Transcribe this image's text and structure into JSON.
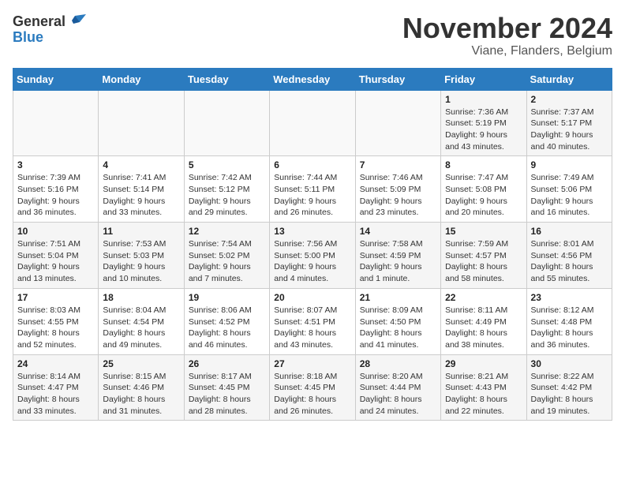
{
  "logo": {
    "general": "General",
    "blue": "Blue"
  },
  "title": {
    "month": "November 2024",
    "location": "Viane, Flanders, Belgium"
  },
  "headers": [
    "Sunday",
    "Monday",
    "Tuesday",
    "Wednesday",
    "Thursday",
    "Friday",
    "Saturday"
  ],
  "weeks": [
    [
      {
        "day": "",
        "info": ""
      },
      {
        "day": "",
        "info": ""
      },
      {
        "day": "",
        "info": ""
      },
      {
        "day": "",
        "info": ""
      },
      {
        "day": "",
        "info": ""
      },
      {
        "day": "1",
        "info": "Sunrise: 7:36 AM\nSunset: 5:19 PM\nDaylight: 9 hours and 43 minutes."
      },
      {
        "day": "2",
        "info": "Sunrise: 7:37 AM\nSunset: 5:17 PM\nDaylight: 9 hours and 40 minutes."
      }
    ],
    [
      {
        "day": "3",
        "info": "Sunrise: 7:39 AM\nSunset: 5:16 PM\nDaylight: 9 hours and 36 minutes."
      },
      {
        "day": "4",
        "info": "Sunrise: 7:41 AM\nSunset: 5:14 PM\nDaylight: 9 hours and 33 minutes."
      },
      {
        "day": "5",
        "info": "Sunrise: 7:42 AM\nSunset: 5:12 PM\nDaylight: 9 hours and 29 minutes."
      },
      {
        "day": "6",
        "info": "Sunrise: 7:44 AM\nSunset: 5:11 PM\nDaylight: 9 hours and 26 minutes."
      },
      {
        "day": "7",
        "info": "Sunrise: 7:46 AM\nSunset: 5:09 PM\nDaylight: 9 hours and 23 minutes."
      },
      {
        "day": "8",
        "info": "Sunrise: 7:47 AM\nSunset: 5:08 PM\nDaylight: 9 hours and 20 minutes."
      },
      {
        "day": "9",
        "info": "Sunrise: 7:49 AM\nSunset: 5:06 PM\nDaylight: 9 hours and 16 minutes."
      }
    ],
    [
      {
        "day": "10",
        "info": "Sunrise: 7:51 AM\nSunset: 5:04 PM\nDaylight: 9 hours and 13 minutes."
      },
      {
        "day": "11",
        "info": "Sunrise: 7:53 AM\nSunset: 5:03 PM\nDaylight: 9 hours and 10 minutes."
      },
      {
        "day": "12",
        "info": "Sunrise: 7:54 AM\nSunset: 5:02 PM\nDaylight: 9 hours and 7 minutes."
      },
      {
        "day": "13",
        "info": "Sunrise: 7:56 AM\nSunset: 5:00 PM\nDaylight: 9 hours and 4 minutes."
      },
      {
        "day": "14",
        "info": "Sunrise: 7:58 AM\nSunset: 4:59 PM\nDaylight: 9 hours and 1 minute."
      },
      {
        "day": "15",
        "info": "Sunrise: 7:59 AM\nSunset: 4:57 PM\nDaylight: 8 hours and 58 minutes."
      },
      {
        "day": "16",
        "info": "Sunrise: 8:01 AM\nSunset: 4:56 PM\nDaylight: 8 hours and 55 minutes."
      }
    ],
    [
      {
        "day": "17",
        "info": "Sunrise: 8:03 AM\nSunset: 4:55 PM\nDaylight: 8 hours and 52 minutes."
      },
      {
        "day": "18",
        "info": "Sunrise: 8:04 AM\nSunset: 4:54 PM\nDaylight: 8 hours and 49 minutes."
      },
      {
        "day": "19",
        "info": "Sunrise: 8:06 AM\nSunset: 4:52 PM\nDaylight: 8 hours and 46 minutes."
      },
      {
        "day": "20",
        "info": "Sunrise: 8:07 AM\nSunset: 4:51 PM\nDaylight: 8 hours and 43 minutes."
      },
      {
        "day": "21",
        "info": "Sunrise: 8:09 AM\nSunset: 4:50 PM\nDaylight: 8 hours and 41 minutes."
      },
      {
        "day": "22",
        "info": "Sunrise: 8:11 AM\nSunset: 4:49 PM\nDaylight: 8 hours and 38 minutes."
      },
      {
        "day": "23",
        "info": "Sunrise: 8:12 AM\nSunset: 4:48 PM\nDaylight: 8 hours and 36 minutes."
      }
    ],
    [
      {
        "day": "24",
        "info": "Sunrise: 8:14 AM\nSunset: 4:47 PM\nDaylight: 8 hours and 33 minutes."
      },
      {
        "day": "25",
        "info": "Sunrise: 8:15 AM\nSunset: 4:46 PM\nDaylight: 8 hours and 31 minutes."
      },
      {
        "day": "26",
        "info": "Sunrise: 8:17 AM\nSunset: 4:45 PM\nDaylight: 8 hours and 28 minutes."
      },
      {
        "day": "27",
        "info": "Sunrise: 8:18 AM\nSunset: 4:45 PM\nDaylight: 8 hours and 26 minutes."
      },
      {
        "day": "28",
        "info": "Sunrise: 8:20 AM\nSunset: 4:44 PM\nDaylight: 8 hours and 24 minutes."
      },
      {
        "day": "29",
        "info": "Sunrise: 8:21 AM\nSunset: 4:43 PM\nDaylight: 8 hours and 22 minutes."
      },
      {
        "day": "30",
        "info": "Sunrise: 8:22 AM\nSunset: 4:42 PM\nDaylight: 8 hours and 19 minutes."
      }
    ]
  ]
}
